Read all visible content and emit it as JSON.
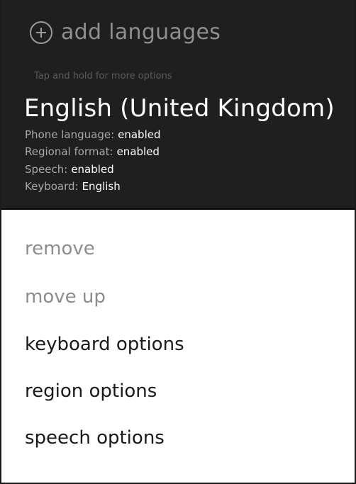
{
  "header": {
    "add_label": "add languages",
    "hint": "Tap and hold for more options"
  },
  "language": {
    "name": "English (United Kingdom)",
    "details": [
      {
        "label": "Phone language:",
        "value": "enabled"
      },
      {
        "label": "Regional format:",
        "value": "enabled"
      },
      {
        "label": "Speech:",
        "value": "enabled"
      },
      {
        "label": "Keyboard:",
        "value": "English"
      }
    ]
  },
  "context_menu": {
    "items": [
      {
        "label": "remove",
        "enabled": false
      },
      {
        "label": "move up",
        "enabled": false
      },
      {
        "label": "keyboard options",
        "enabled": true
      },
      {
        "label": "region options",
        "enabled": true
      },
      {
        "label": "speech options",
        "enabled": true
      }
    ]
  },
  "icons": {
    "add": "plus-circle-icon"
  },
  "colors": {
    "dark_background": "#1f1f1f",
    "menu_background": "#ffffff",
    "disabled_text": "#8d8d8d",
    "enabled_text": "#1a1a1a"
  }
}
